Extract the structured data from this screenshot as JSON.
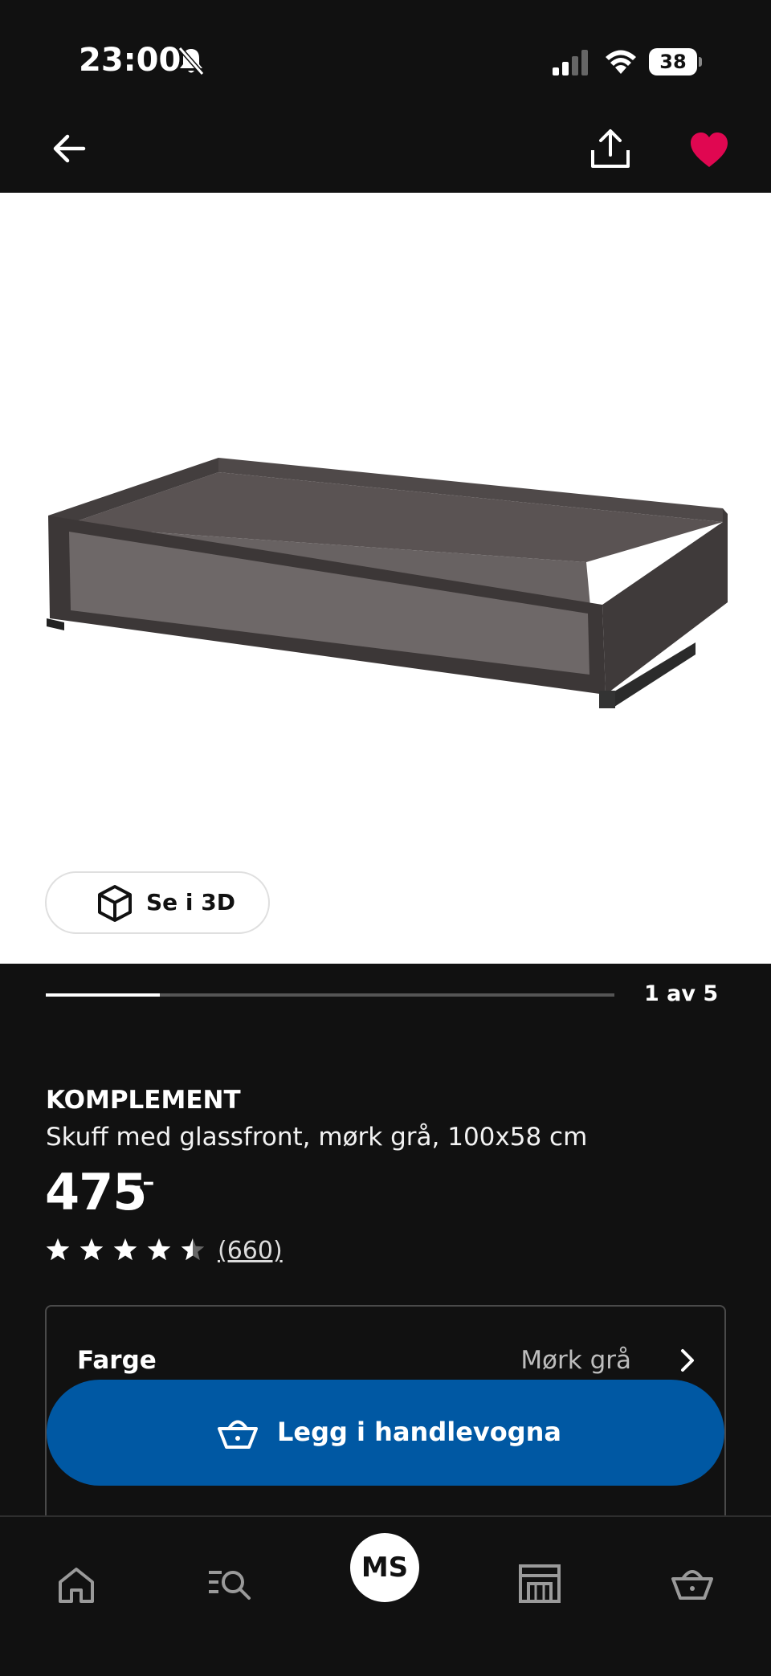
{
  "status_bar": {
    "time": "23:00",
    "battery": "38"
  },
  "colors": {
    "background": "#111111",
    "cart_button": "#0058a3",
    "favorite": "#e00751",
    "product": "#4a4444"
  },
  "top_nav": {
    "icons": [
      "arrow-left-icon",
      "share-icon",
      "heart-icon"
    ]
  },
  "gallery": {
    "view_3d_label": "Se i 3D",
    "pager_text": "1 av 5",
    "current": 1,
    "total": 5,
    "progress": 0.2
  },
  "product": {
    "brand": "KOMPLEMENT",
    "description": "Skuff med glassfront, mørk grå, 100x58 cm",
    "price": "475",
    "price_suffix": ",–",
    "rating": 4.5,
    "reviews": "(660)"
  },
  "option": {
    "label": "Farge",
    "value": "Mørk grå"
  },
  "cart_button": {
    "label": "Legg i handlevogna"
  },
  "tabbar": {
    "profile_initials": "MS",
    "icons": [
      "home-icon",
      "search-list-icon",
      "profile-avatar",
      "store-icon",
      "basket-icon"
    ]
  }
}
